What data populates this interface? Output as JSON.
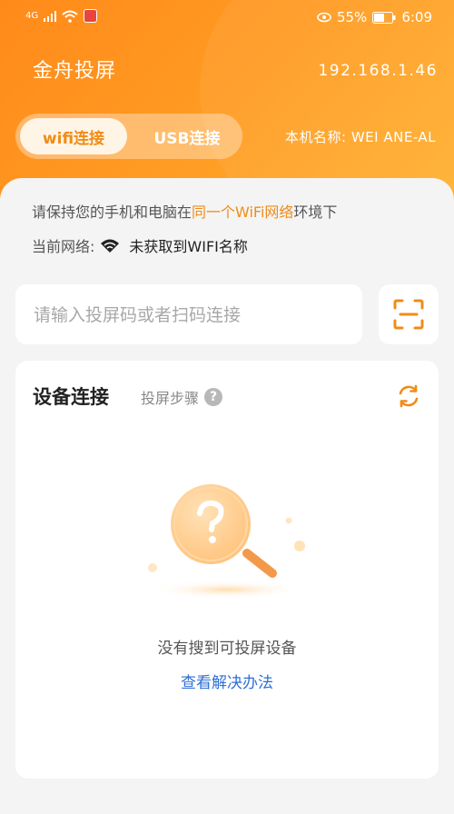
{
  "status_bar": {
    "signal": "4G",
    "battery": "55%",
    "time": "6:09"
  },
  "header": {
    "app_title": "金舟投屏",
    "ip_address": "192.168.1.46",
    "tabs": [
      {
        "label": "wifi连接",
        "active": true
      },
      {
        "label": "USB连接",
        "active": false
      }
    ],
    "device_name": "本机名称: WEI  ANE-AL"
  },
  "info": {
    "tip_prefix": "请保持您的手机和电脑在",
    "tip_highlight": "同一个WiFi网络",
    "tip_suffix": "环境下",
    "network_label": "当前网络:",
    "network_value": "未获取到WIFI名称"
  },
  "search": {
    "placeholder": "请输入投屏码或者扫码连接"
  },
  "device_panel": {
    "title": "设备连接",
    "steps_label": "投屏步骤",
    "help_symbol": "?",
    "empty_text": "没有搜到可投屏设备",
    "solution_link": "查看解决办法"
  },
  "colors": {
    "accent": "#f08c17",
    "link": "#2f6fd6"
  },
  "icons": [
    "wifi-icon",
    "scan-icon",
    "refresh-icon",
    "help-icon",
    "magnifier-question-icon",
    "battery-icon",
    "eye-icon"
  ]
}
